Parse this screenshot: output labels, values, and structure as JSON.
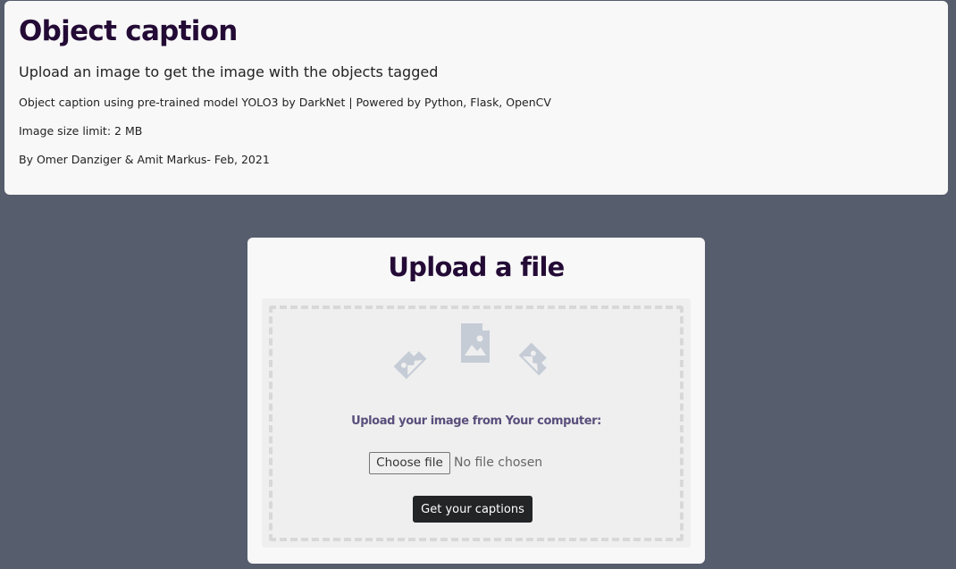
{
  "header": {
    "title": "Object caption",
    "subtitle": "Upload an image to get the image with the objects tagged",
    "description": "Object caption using pre-trained model YOLO3 by DarkNet | Powered by Python, Flask, OpenCV",
    "size_limit": "Image size limit: 2 MB",
    "credits": "By Omer Danziger & Amit Markus- Feb, 2021"
  },
  "upload": {
    "title": "Upload a file",
    "instructions": "Upload your image from Your computer:",
    "choose_file_label": "Choose file",
    "file_status": "No file chosen",
    "submit_label": "Get your captions",
    "icons": [
      "image-file-icon",
      "image-file-icon",
      "image-file-icon"
    ]
  },
  "colors": {
    "background": "#565d6d",
    "card": "#f8f8f8",
    "title": "#240b36",
    "instructions": "#5a4f7c",
    "icon": "#c5ccd6",
    "button": "#222426"
  }
}
